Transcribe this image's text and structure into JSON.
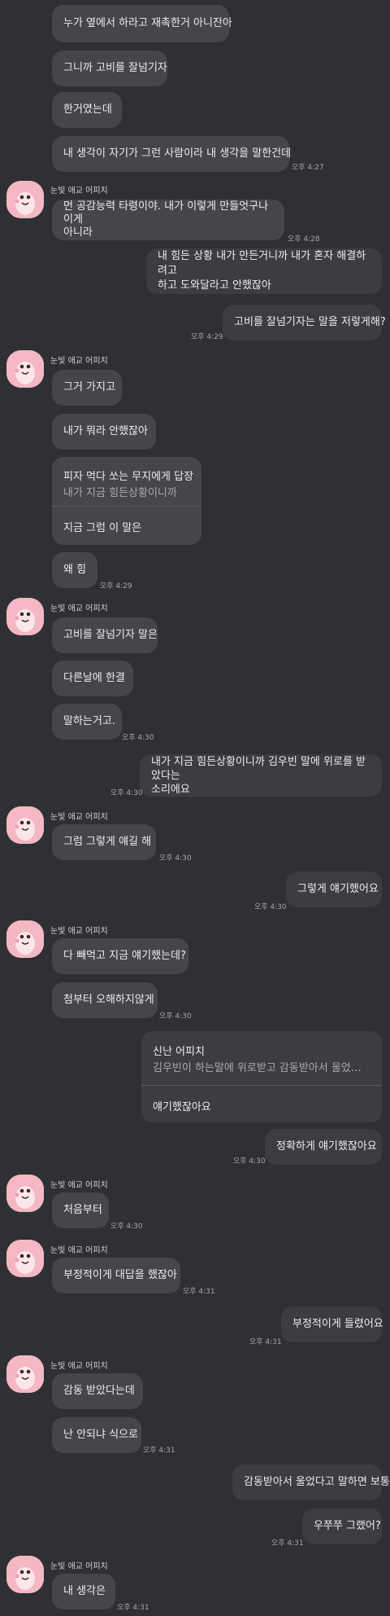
{
  "sender_name": "눈빛 애교 어피치",
  "messages": [
    {
      "text": "누가 옆에서 하라고 재촉한거 아니잔아"
    },
    {
      "text": "그니까 고비를 잘넘기자"
    },
    {
      "text": "한거였는데"
    },
    {
      "text": "내 생각이 자기가 그런 사람이라 내 생각을 말한건데",
      "time": "오후 4:27"
    },
    {
      "line1": "먼 공감능력 타령이야. 내가 이렇게 만들엇구나 이게",
      "line2": "아니라",
      "time": "오후 4:28"
    },
    {
      "line1": "내 힘든 상황 내가 만든거니까 내가 혼자 해결하려고",
      "line2": "하고 도와달라고 안했잖아"
    },
    {
      "text": "고비를 잘넘기자는 말을 저렇게해?",
      "time": "오후 4:29"
    },
    {
      "text": "그거 가지고"
    },
    {
      "text": "내가 뭐라 안했잖아"
    },
    {
      "reply_title": "피자 먹다 쏘는 무지에게 답장",
      "reply_sub": "내가 지금 힘든상황이니까",
      "reply_text": "지금 그럼 이 말은"
    },
    {
      "text": "왜 힘",
      "time": "오후 4:29"
    },
    {
      "text": "고비를 잘넘기자 말은"
    },
    {
      "text": "다른날에 한결"
    },
    {
      "text": "말하는거고.",
      "time": "오후 4:30"
    },
    {
      "line1": "내가 지금 힘든상황이니까 김우빈 말에 위로를 받았다는",
      "line2": "소리에요",
      "time": "오후 4:30"
    },
    {
      "text": "그럼 그렇게 얘길 해",
      "time": "오후 4:30"
    },
    {
      "text": "그렇게 얘기했어요",
      "time": "오후 4:30"
    },
    {
      "text": "다 빼먹고 지금 얘기했는데?"
    },
    {
      "text": "첨부터 오해하지않게",
      "time": "오후 4:30"
    },
    {
      "reply_title": "신난 어피치",
      "reply_sub": "김우빈이 하는말에 위로받고 감동받아서 울었…",
      "reply_text": "얘기했잖아요"
    },
    {
      "text": "정확하게 얘기했잖아요",
      "time": "오후 4:30"
    },
    {
      "text": "처음부터",
      "time": "오후 4:30"
    },
    {
      "text": "부정적이게 대답을 했잖아",
      "time": "오후 4:31"
    },
    {
      "text": "부정적이게 들렸어요",
      "time": "오후 4:31"
    },
    {
      "text": "감동 받았다는데"
    },
    {
      "text": "난 안되냐 식으로",
      "time": "오후 4:31"
    },
    {
      "text": "감동받아서 울었다고 말하면 보통"
    },
    {
      "text": "우쭈쭈 그랬어?",
      "time": "오후 4:31"
    },
    {
      "text": "내 생각은",
      "time": "오후 4:31"
    }
  ]
}
